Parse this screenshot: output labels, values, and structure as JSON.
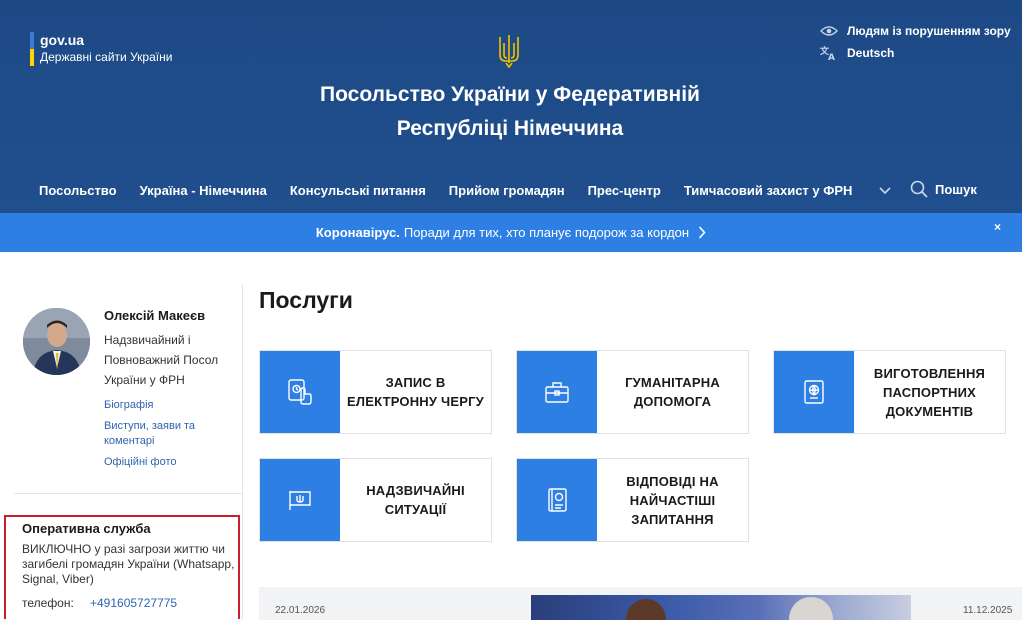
{
  "header": {
    "gov_name": "gov.ua",
    "gov_sub": "Державні сайти України",
    "title_line1": "Посольство України у Федеративній",
    "title_line2": "Республіці Німеччина",
    "accessibility": "Людям із порушенням зору",
    "language": "Deutsch",
    "search": "Пошук",
    "nav": [
      "Посольство",
      "Україна - Німеччина",
      "Консульські питання",
      "Прийом громадян",
      "Прес-центр",
      "Тимчасовий захист у ФРН"
    ]
  },
  "banner": {
    "bold": "Коронавірус.",
    "text": "Поради для тих, хто планує подорож за кордон",
    "close": "×"
  },
  "sidebar": {
    "name": "Олексій Макеєв",
    "role": "Надзвичайний і Повноважний Посол України у ФРН",
    "links": [
      "Біографія",
      "Виступи, заяви та коментарі",
      "Офіційні фото"
    ]
  },
  "operative": {
    "title": "Оперативна служба",
    "text": "ВИКЛЮЧНО у разі загрози життю чи загибелі громадян України (Whatsapp, Signal, Viber)",
    "phone_label": "телефон:",
    "phone": "+491605727775"
  },
  "main": {
    "title": "Послуги",
    "cards": [
      {
        "label": "ЗАПИС В ЕЛЕКТРОННУ ЧЕРГУ",
        "icon": "electronic-queue-icon"
      },
      {
        "label": "ГУМАНІТАРНА ДОПОМОГА",
        "icon": "briefcase-icon"
      },
      {
        "label": "ВИГОТОВЛЕННЯ ПАСПОРТНИХ ДОКУМЕНТІВ",
        "icon": "passport-icon"
      },
      {
        "label": "НАДЗВИЧАЙНІ СИТУАЦІЇ",
        "icon": "flag-icon"
      },
      {
        "label": "ВІДПОВІДІ НА НАЙЧАСТІШІ ЗАПИТАННЯ",
        "icon": "faq-book-icon"
      }
    ]
  },
  "news": {
    "date1": "22.01.2026",
    "date2": "11.12.2025"
  },
  "colors": {
    "header_bg": "#1f4e8c",
    "accent": "#2e7fe4",
    "link": "#2e65b0",
    "highlight_border": "#c8202f"
  }
}
